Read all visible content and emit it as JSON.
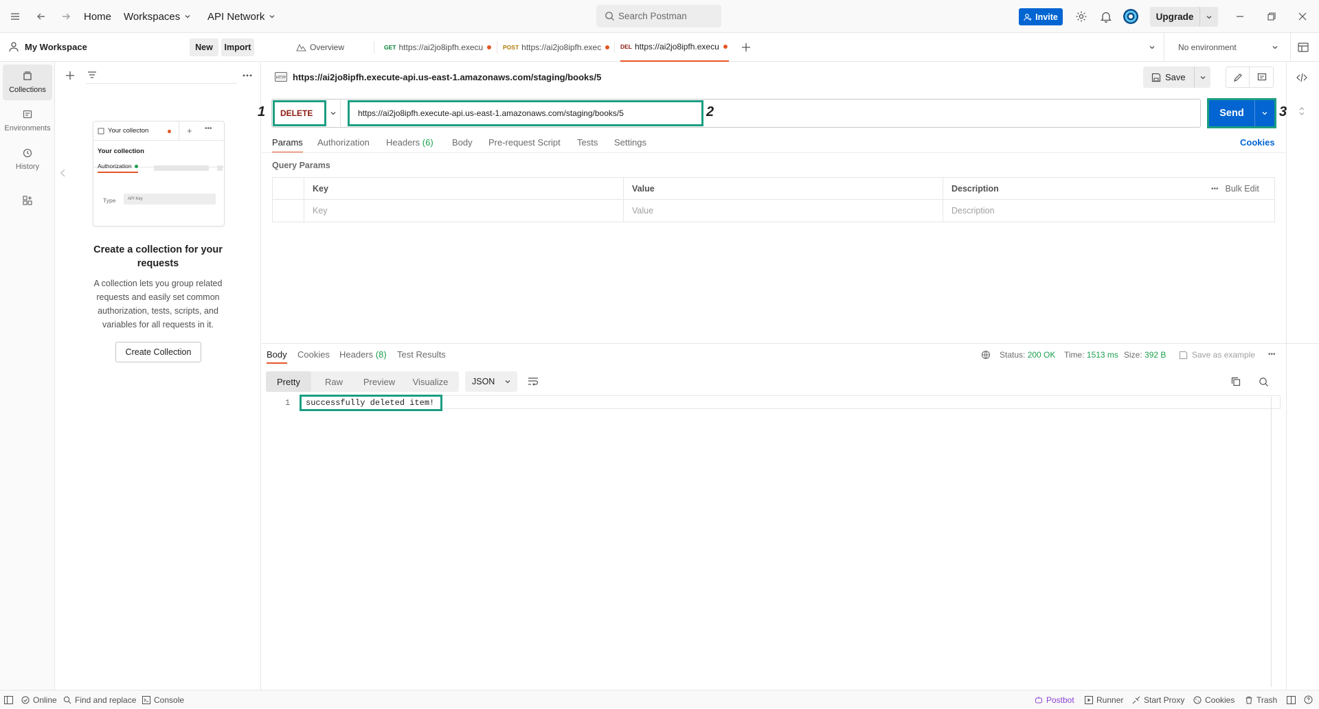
{
  "topbar": {
    "nav": {
      "home": "Home",
      "workspaces": "Workspaces",
      "api_network": "API Network"
    },
    "search_placeholder": "Search Postman",
    "invite": "Invite",
    "upgrade": "Upgrade"
  },
  "sidebar": {
    "workspace_name": "My Workspace",
    "new_label": "New",
    "import_label": "Import",
    "rail": [
      {
        "label": "Collections",
        "icon": "collections-icon",
        "active": true
      },
      {
        "label": "Environments",
        "icon": "environments-icon",
        "active": false
      },
      {
        "label": "History",
        "icon": "history-icon",
        "active": false
      }
    ],
    "preview": {
      "tab_label": "Your collecton",
      "collection_name": "Your collection",
      "tab_authorization": "Authorization",
      "type_label": "Type",
      "type_value": "API Key"
    },
    "empty_title": "Create a collection for your requests",
    "empty_desc": "A collection lets you group related requests and easily set common authorization, tests, scripts, and variables for all requests in it.",
    "create_button": "Create Collection"
  },
  "tabs": [
    {
      "label": "Overview",
      "method": ""
    },
    {
      "method": "GET",
      "label": "https://ai2jo8ipfh.execu",
      "method_color": "#007f31"
    },
    {
      "method": "POST",
      "label": "https://ai2jo8ipfh.exec",
      "method_color": "#ad7a03"
    },
    {
      "method": "DEL",
      "label": "https://ai2jo8ipfh.execu",
      "method_color": "#8e1a10"
    }
  ],
  "environment": "No environment",
  "request": {
    "title": "https://ai2jo8ipfh.execute-api.us-east-1.amazonaws.com/staging/books/5",
    "save_label": "Save",
    "method": "DELETE",
    "url": "https://ai2jo8ipfh.execute-api.us-east-1.amazonaws.com/staging/books/5",
    "send_label": "Send",
    "callouts": [
      "1",
      "2",
      "3"
    ],
    "tabs": {
      "params": "Params",
      "authorization": "Authorization",
      "headers": "Headers",
      "headers_count": "(6)",
      "body": "Body",
      "prerequest": "Pre-request Script",
      "tests": "Tests",
      "settings": "Settings"
    },
    "cookies_link": "Cookies",
    "query_params_label": "Query Params",
    "table": {
      "headers": [
        "Key",
        "Value",
        "Description"
      ],
      "placeholders": [
        "Key",
        "Value",
        "Description"
      ],
      "bulk_edit": "Bulk Edit"
    }
  },
  "response": {
    "tabs": {
      "body": "Body",
      "cookies": "Cookies",
      "headers": "Headers",
      "headers_count": "(8)",
      "test_results": "Test Results"
    },
    "status_label": "Status:",
    "status_value": "200 OK",
    "time_label": "Time:",
    "time_value": "1513 ms",
    "size_label": "Size:",
    "size_value": "392 B",
    "save_example": "Save as example",
    "views": [
      "Pretty",
      "Raw",
      "Preview",
      "Visualize"
    ],
    "format": "JSON",
    "line_number": "1",
    "body_text": "successfully deleted item!"
  },
  "statusbar": {
    "online": "Online",
    "find_replace": "Find and replace",
    "console": "Console",
    "postbot": "Postbot",
    "runner": "Runner",
    "start_proxy": "Start Proxy",
    "cookies": "Cookies",
    "trash": "Trash"
  },
  "colors": {
    "accent": "#e45624",
    "primary_blue": "#0265d2",
    "annotation_green": "#1a9e82",
    "success_green": "#1a9e4c",
    "delete_red": "#8e1a10"
  }
}
